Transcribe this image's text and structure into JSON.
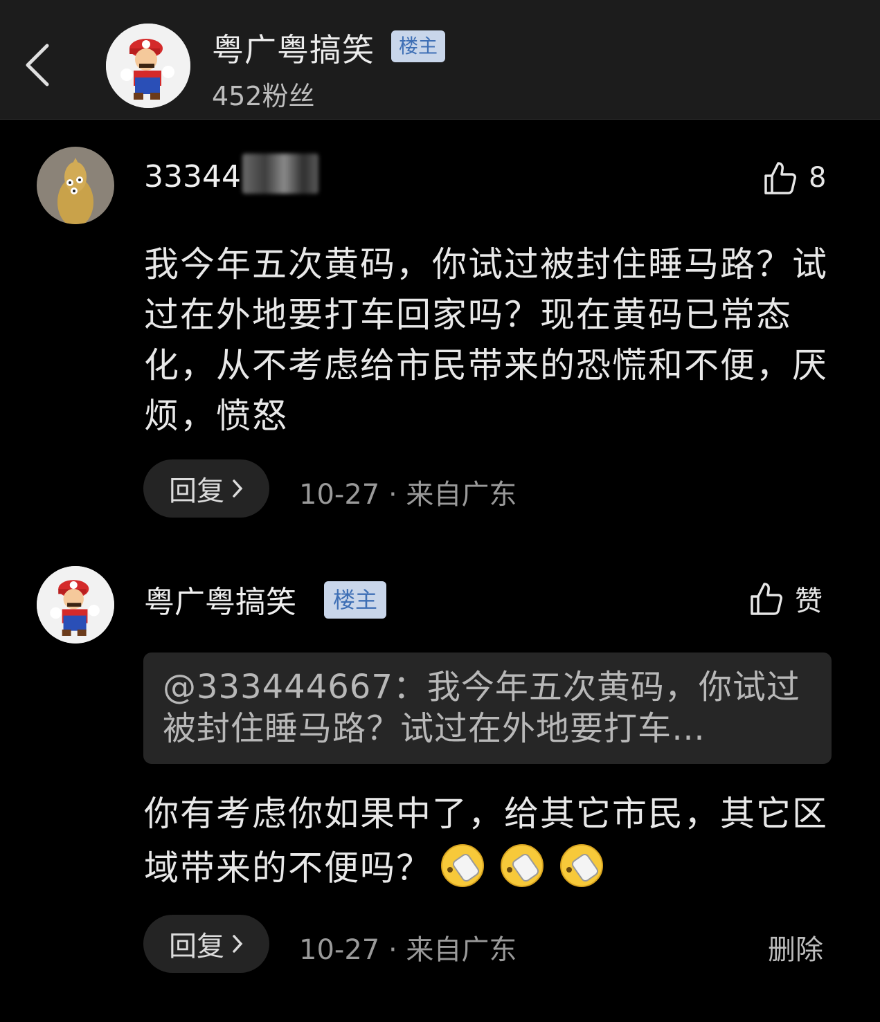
{
  "header": {
    "title": "粤广粤搞笑",
    "badge": "楼主",
    "fans": "452粉丝",
    "icons": {
      "back": "back-chevron-icon",
      "avatar": "mario-avatar"
    }
  },
  "comment1": {
    "username": "33344",
    "likes": "8",
    "text": "我今年五次黄码，你试过被封住睡马路？试过在外地要打车回家吗？现在黄码已常态化，从不考虑给市民带来的恐慌和不便，厌烦，愤怒",
    "reply_label": "回复",
    "meta": "10-27 · 来自广东"
  },
  "comment2": {
    "username": "粤广粤搞笑",
    "badge": "楼主",
    "like_label": "赞",
    "quote": "@333444667：我今年五次黄码，你试过被封住睡马路？试过在外地要打车…",
    "text": "你有考虑你如果中了，给其它市民，其它区域带来的不便吗？",
    "reply_label": "回复",
    "meta": "10-27 · 来自广东",
    "delete_label": "删除"
  },
  "colors": {
    "background": "#000000",
    "header_bg": "#1c1c1c",
    "badge_bg": "#c9d6ea",
    "badge_text": "#3e6fb5",
    "pill_bg": "#242424"
  }
}
